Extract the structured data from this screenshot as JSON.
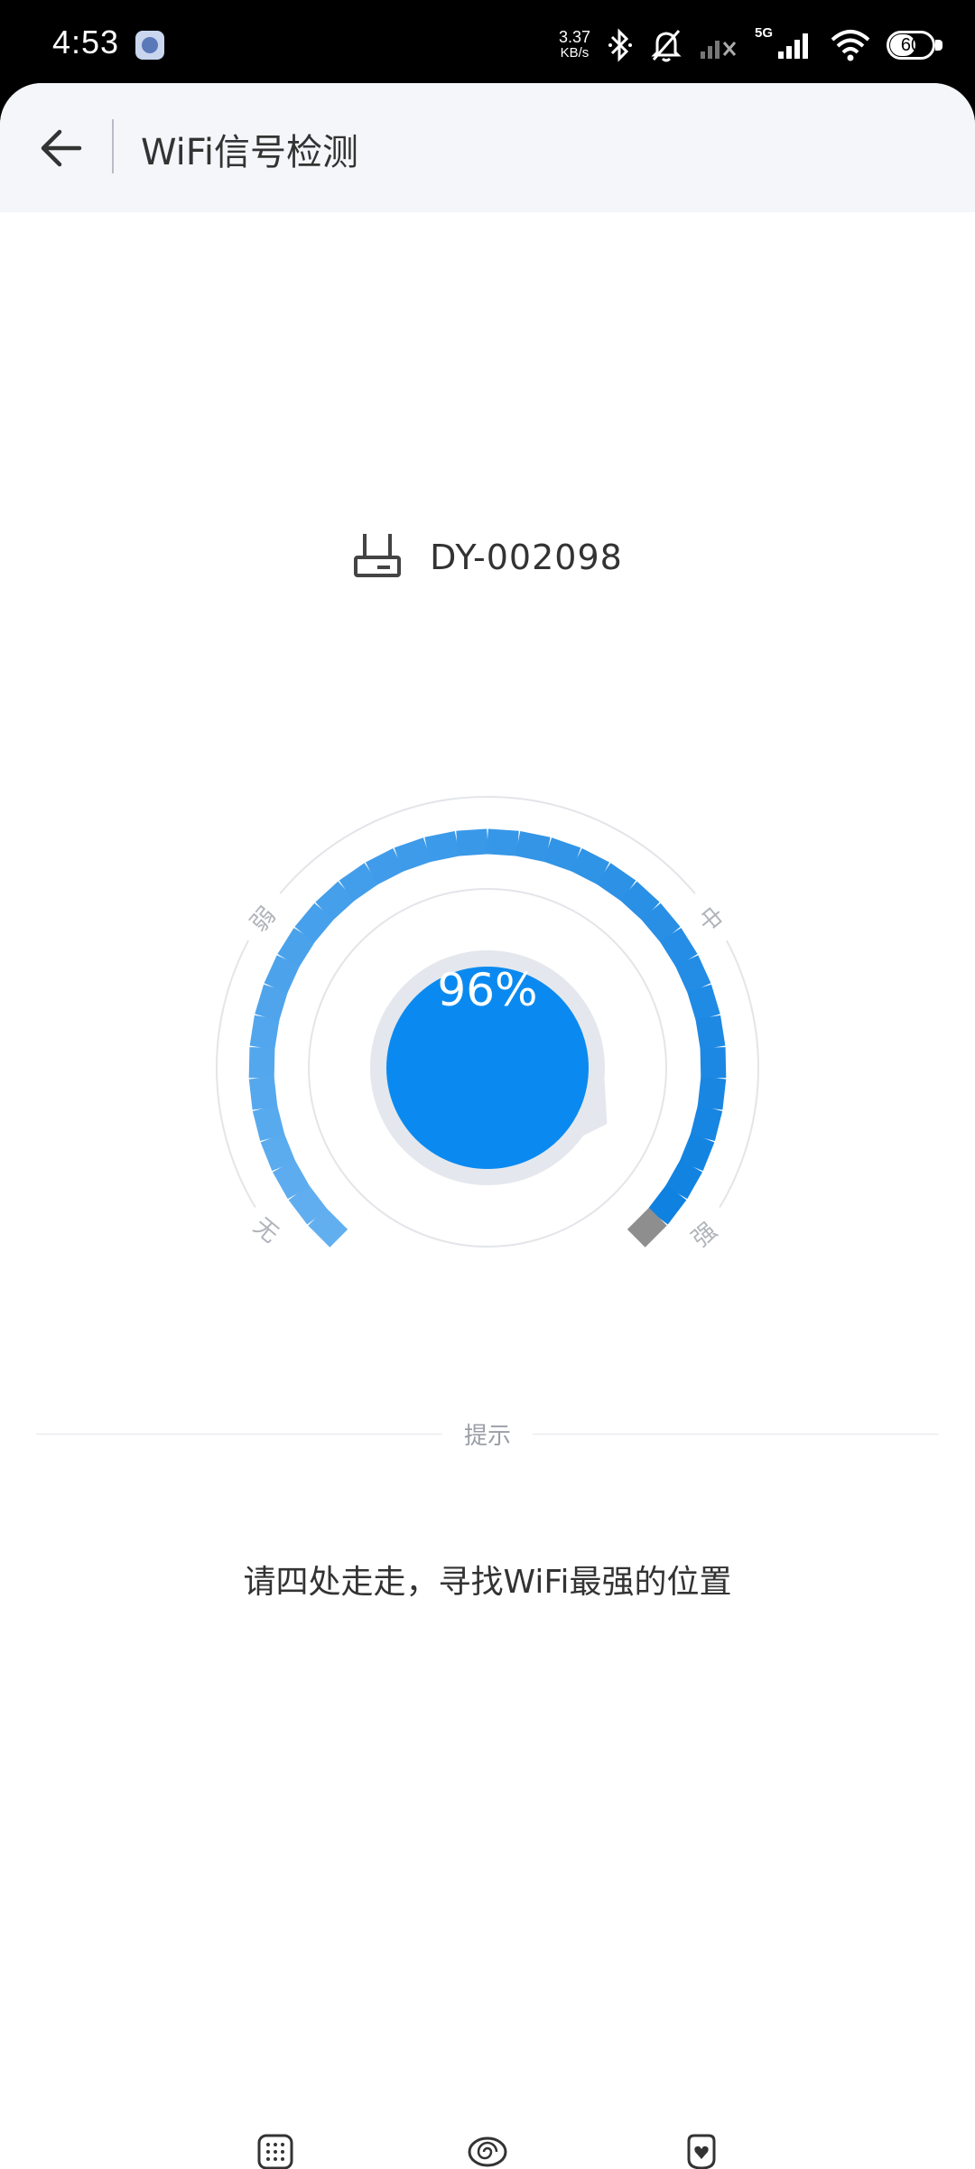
{
  "status_bar": {
    "time": "4:53",
    "speed_value": "3.37",
    "speed_unit": "KB/s",
    "network_label": "5G",
    "battery_level": "60",
    "icons": [
      "app-notification-icon",
      "bluetooth-icon",
      "mute-bell-icon",
      "signal-sim1-icon",
      "signal-5g-icon",
      "wifi-icon",
      "battery-icon"
    ]
  },
  "header": {
    "title": "WiFi信号检测",
    "back_icon": "arrow-left-icon"
  },
  "device": {
    "icon": "router-icon",
    "name": "DY-002098"
  },
  "gauge": {
    "value_text": "96%",
    "value": 0.96,
    "labels": {
      "weak": "弱",
      "medium": "中",
      "none": "无",
      "strong": "强"
    },
    "colors": {
      "segment_light": "#62aff0",
      "segment_dark": "#0d80e0",
      "segment_inactive": "#8e8e8e",
      "center": "#0a8af0"
    }
  },
  "tips": {
    "label": "提示",
    "text": "请四处走走，寻找WiFi最强的位置"
  },
  "bottom_nav": [
    {
      "name": "nav-grid-icon"
    },
    {
      "name": "nav-spiral-icon"
    },
    {
      "name": "nav-heart-icon"
    }
  ]
}
